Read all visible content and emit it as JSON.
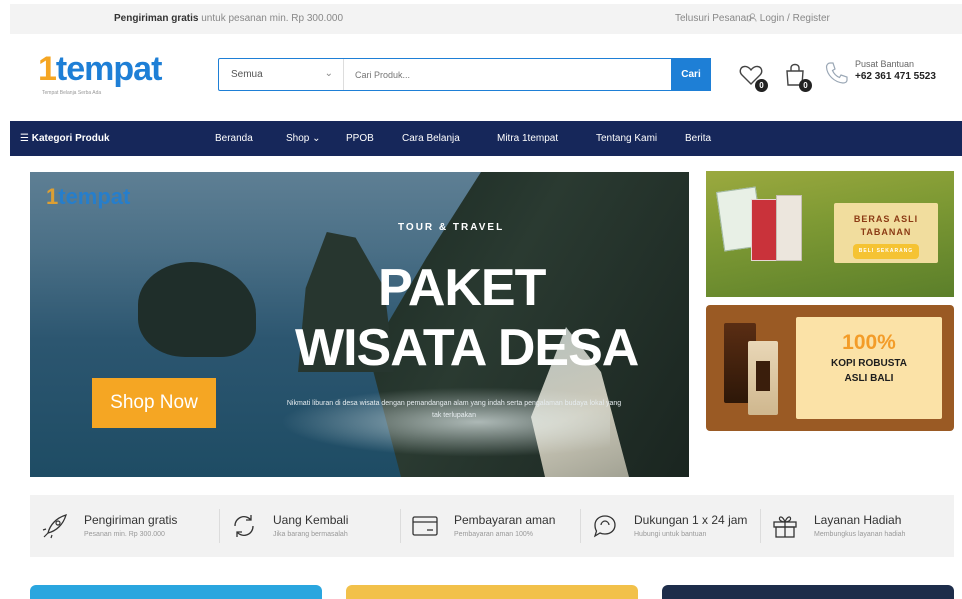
{
  "topbar": {
    "shipping_bold": "Pengiriman gratis",
    "shipping_text": " untuk pesanan min. Rp 300.000",
    "track_order": "Telusuri Pesanan",
    "login": "Login",
    "separator": "/",
    "register": "Register"
  },
  "header": {
    "logo_one": "1",
    "logo_rest": "tempat",
    "logo_tagline": "Tempat Belanja Serba Ada",
    "search_category": "Semua",
    "search_placeholder": "Cari Produk...",
    "search_button": "Cari",
    "wishlist_count": "0",
    "cart_count": "0",
    "help_label": "Pusat Bantuan",
    "help_phone": "+62 361 471 5523"
  },
  "nav": {
    "categories": "☰  Kategori Produk",
    "items": [
      "Beranda",
      "Shop  ⌄",
      "PPOB",
      "Cara Belanja",
      "Mitra 1tempat",
      "Tentang Kami",
      "Berita"
    ]
  },
  "hero": {
    "logo_one": "1",
    "logo_rest": "tempat",
    "subtitle": "TOUR & TRAVEL",
    "title_line1": "PAKET",
    "title_line2": "WISATA DESA",
    "description": "Nikmati liburan di desa wisata dengan pemandangan alam yang indah serta pengalaman budaya lokal yang tak terlupakan",
    "shop_button": "Shop Now"
  },
  "side_banner_1": {
    "line1": "BERAS ASLI",
    "line2": "TABANAN",
    "pill": "BELI SEKARANG"
  },
  "side_banner_2": {
    "percent": "100%",
    "line1": "KOPI ROBUSTA",
    "line2": "ASLI BALI"
  },
  "features": [
    {
      "title": "Pengiriman gratis",
      "desc": "Pesanan min. Rp 300.000",
      "icon": "rocket-icon"
    },
    {
      "title": "Uang Kembali",
      "desc": "Jika barang bermasalah",
      "icon": "refresh-icon"
    },
    {
      "title": "Pembayaran aman",
      "desc": "Pembayaran aman 100%",
      "icon": "credit-card-icon"
    },
    {
      "title": "Dukungan 1 x 24 jam",
      "desc": "Hubungi untuk bantuan",
      "icon": "chat-support-icon"
    },
    {
      "title": "Layanan Hadiah",
      "desc": "Membungkus layanan hadiah",
      "icon": "gift-icon"
    }
  ],
  "colors": {
    "brand_blue": "#1e7fd6",
    "brand_orange": "#f5a623",
    "nav_navy": "#16275a"
  }
}
